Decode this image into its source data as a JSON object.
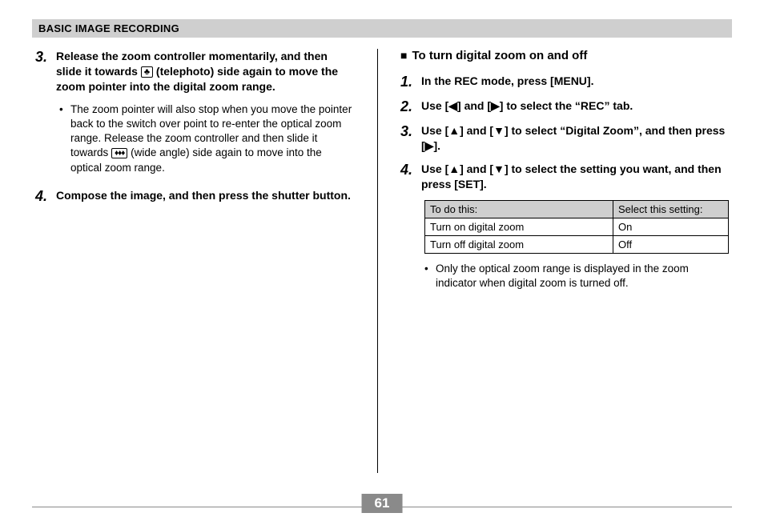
{
  "header": "BASIC IMAGE RECORDING",
  "page_number": "61",
  "left": {
    "step3_num": "3.",
    "step3_lead": "Release the zoom controller momentarily, and then slide it towards ",
    "step3_tail": " (telephoto) side again to move the zoom pointer into the digital zoom range.",
    "step3_bullet_lead": "The zoom pointer will also stop when you move the pointer back to the switch over point to re-enter the optical zoom range. Release the zoom controller and then slide it towards ",
    "step3_bullet_tail": " (wide angle) side again to move into the optical zoom range.",
    "step4_num": "4.",
    "step4": "Compose the image, and then press the shutter button."
  },
  "right": {
    "subhead": "To turn digital zoom on and off",
    "step1_num": "1.",
    "step1": "In the REC mode, press [MENU].",
    "step2_num": "2.",
    "step2_lead": "Use [",
    "step2_mid": "] and [",
    "step2_tail": "] to select the “REC” tab.",
    "step3_num": "3.",
    "step3_lead": "Use [",
    "step3_mid": "] and [",
    "step3_mid2": "] to select “Digital Zoom”, and then press [",
    "step3_tail": "].",
    "step4_num": "4.",
    "step4_lead": "Use [",
    "step4_mid": "] and [",
    "step4_tail": "] to select the setting you want, and then press [SET].",
    "table_head_a": "To do this:",
    "table_head_b": "Select this setting:",
    "table_r1_a": "Turn on digital zoom",
    "table_r1_b": "On",
    "table_r2_a": "Turn off digital zoom",
    "table_r2_b": "Off",
    "table_note": "Only the optical zoom range is displayed in the zoom indicator when digital zoom is turned off."
  },
  "glyphs": {
    "tele": "♣",
    "wide": "♦♦♦",
    "left": "◀",
    "right": "▶",
    "up": "▲",
    "down": "▼",
    "square": "■"
  }
}
